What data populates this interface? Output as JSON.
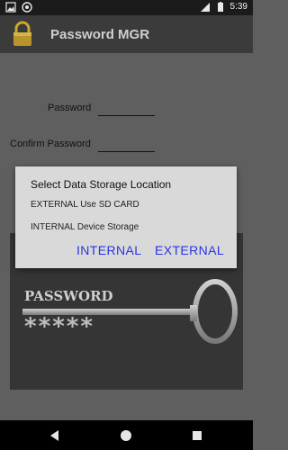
{
  "status_bar": {
    "time": "5:39",
    "icons": [
      "image-icon",
      "record-icon",
      "signal-icon",
      "battery-icon"
    ]
  },
  "app": {
    "title": "Password MGR",
    "logo_icon": "padlock-icon"
  },
  "form": {
    "password_label": "Password",
    "confirm_label": "Confirm Password"
  },
  "dialog": {
    "title": "Select Data Storage Location",
    "options": [
      "EXTERNAL Use SD CARD",
      "INTERNAL Device Storage"
    ],
    "buttons": {
      "internal": "INTERNAL",
      "external": "EXTERNAL"
    },
    "accent_color": "#2b34e0"
  },
  "banner": {
    "word": "PASSWORD",
    "stars": "*****"
  },
  "nav": {
    "icons": [
      "back-icon",
      "home-icon",
      "recents-icon"
    ]
  }
}
